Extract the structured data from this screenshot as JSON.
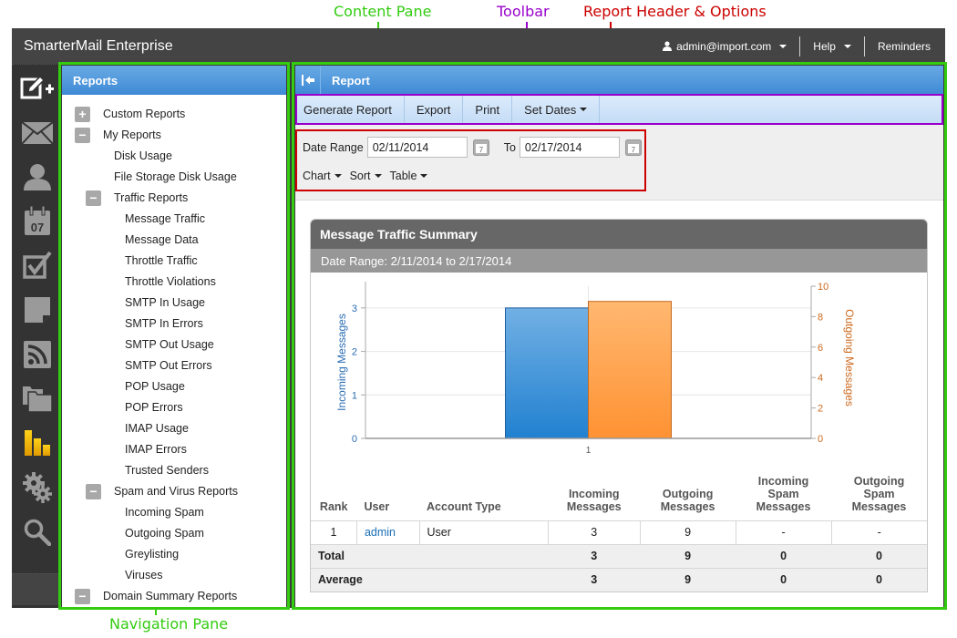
{
  "annotations": {
    "content_pane": "Content Pane",
    "toolbar": "Toolbar",
    "report_header": "Report Header & Options",
    "navigation_pane": "Navigation Pane",
    "colors": {
      "green": "#33cc11",
      "purple": "#9900cc",
      "red": "#cc0000"
    }
  },
  "topbar": {
    "brand": "SmarterMail Enterprise",
    "user": "admin@import.com",
    "help": "Help",
    "reminders": "Reminders"
  },
  "rail": {
    "icons": [
      "compose-icon",
      "mail-icon",
      "contacts-icon",
      "calendar-icon",
      "tasks-icon",
      "notes-icon",
      "rss-icon",
      "files-icon",
      "reports-icon",
      "settings-icon",
      "search-icon"
    ],
    "calendar_day": "07",
    "active": "reports-icon"
  },
  "nav": {
    "title": "Reports",
    "items": [
      {
        "label": "Custom Reports",
        "level": 0,
        "toggle": "+"
      },
      {
        "label": "My Reports",
        "level": 0,
        "toggle": "−"
      },
      {
        "label": "Disk Usage",
        "level": 1
      },
      {
        "label": "File Storage Disk Usage",
        "level": 1
      },
      {
        "label": "Traffic Reports",
        "level": 1,
        "toggle": "−"
      },
      {
        "label": "Message Traffic",
        "level": 2
      },
      {
        "label": "Message Data",
        "level": 2
      },
      {
        "label": "Throttle Traffic",
        "level": 2
      },
      {
        "label": "Throttle Violations",
        "level": 2
      },
      {
        "label": "SMTP In Usage",
        "level": 2
      },
      {
        "label": "SMTP In Errors",
        "level": 2
      },
      {
        "label": "SMTP Out Usage",
        "level": 2
      },
      {
        "label": "SMTP Out Errors",
        "level": 2
      },
      {
        "label": "POP Usage",
        "level": 2
      },
      {
        "label": "POP Errors",
        "level": 2
      },
      {
        "label": "IMAP Usage",
        "level": 2
      },
      {
        "label": "IMAP Errors",
        "level": 2
      },
      {
        "label": "Trusted Senders",
        "level": 2
      },
      {
        "label": "Spam and Virus Reports",
        "level": 1,
        "toggle": "−"
      },
      {
        "label": "Incoming Spam",
        "level": 2
      },
      {
        "label": "Outgoing Spam",
        "level": 2
      },
      {
        "label": "Greylisting",
        "level": 2
      },
      {
        "label": "Viruses",
        "level": 2
      },
      {
        "label": "Domain Summary Reports",
        "level": 0,
        "toggle": "−"
      }
    ]
  },
  "content": {
    "title": "Report",
    "toolbar": {
      "generate": "Generate Report",
      "export": "Export",
      "print": "Print",
      "set_dates": "Set Dates"
    },
    "options": {
      "date_range_label": "Date Range",
      "from_value": "02/11/2014",
      "to_label": "To",
      "to_value": "02/17/2014",
      "chart": "Chart",
      "sort": "Sort",
      "table": "Table"
    },
    "report": {
      "title": "Message Traffic Summary",
      "subtitle": "Date Range: 2/11/2014 to 2/17/2014",
      "table": {
        "headers": [
          {
            "key": "rank",
            "label": "Rank"
          },
          {
            "key": "user",
            "label": "User"
          },
          {
            "key": "account_type",
            "label": "Account Type"
          },
          {
            "key": "incoming",
            "label": "Incoming Messages"
          },
          {
            "key": "outgoing",
            "label": "Outgoing Messages"
          },
          {
            "key": "incoming_spam",
            "label": "Incoming Spam Messages"
          },
          {
            "key": "outgoing_spam",
            "label": "Outgoing Spam Messages"
          }
        ],
        "rows": [
          {
            "rank": "1",
            "user": "admin",
            "account_type": "User",
            "incoming": "3",
            "outgoing": "9",
            "incoming_spam": "-",
            "outgoing_spam": "-"
          }
        ],
        "total": {
          "label": "Total",
          "incoming": "3",
          "outgoing": "9",
          "incoming_spam": "0",
          "outgoing_spam": "0"
        },
        "average": {
          "label": "Average",
          "incoming": "3",
          "outgoing": "9",
          "incoming_spam": "0",
          "outgoing_spam": "0"
        }
      }
    }
  },
  "chart_data": {
    "type": "bar",
    "title": "",
    "categories": [
      "1"
    ],
    "series": [
      {
        "name": "Incoming Messages",
        "values": [
          3
        ],
        "axis": "left",
        "color": "#3d8fd8"
      },
      {
        "name": "Outgoing Messages",
        "values": [
          9
        ],
        "axis": "right",
        "color": "#ffa24a"
      }
    ],
    "xlabel": "",
    "ylabel": "Incoming Messages",
    "ylabel_right": "Outgoing Messages",
    "ylim": [
      0,
      3.5
    ],
    "ylim_right": [
      0,
      10
    ],
    "yticks": [
      0,
      1,
      2,
      3
    ],
    "yticks_right": [
      0,
      2,
      4,
      6,
      8,
      10
    ],
    "ylabel_color": "#2a6db3",
    "ylabel_right_color": "#cc6a1f",
    "grid": true,
    "legend": "none"
  }
}
